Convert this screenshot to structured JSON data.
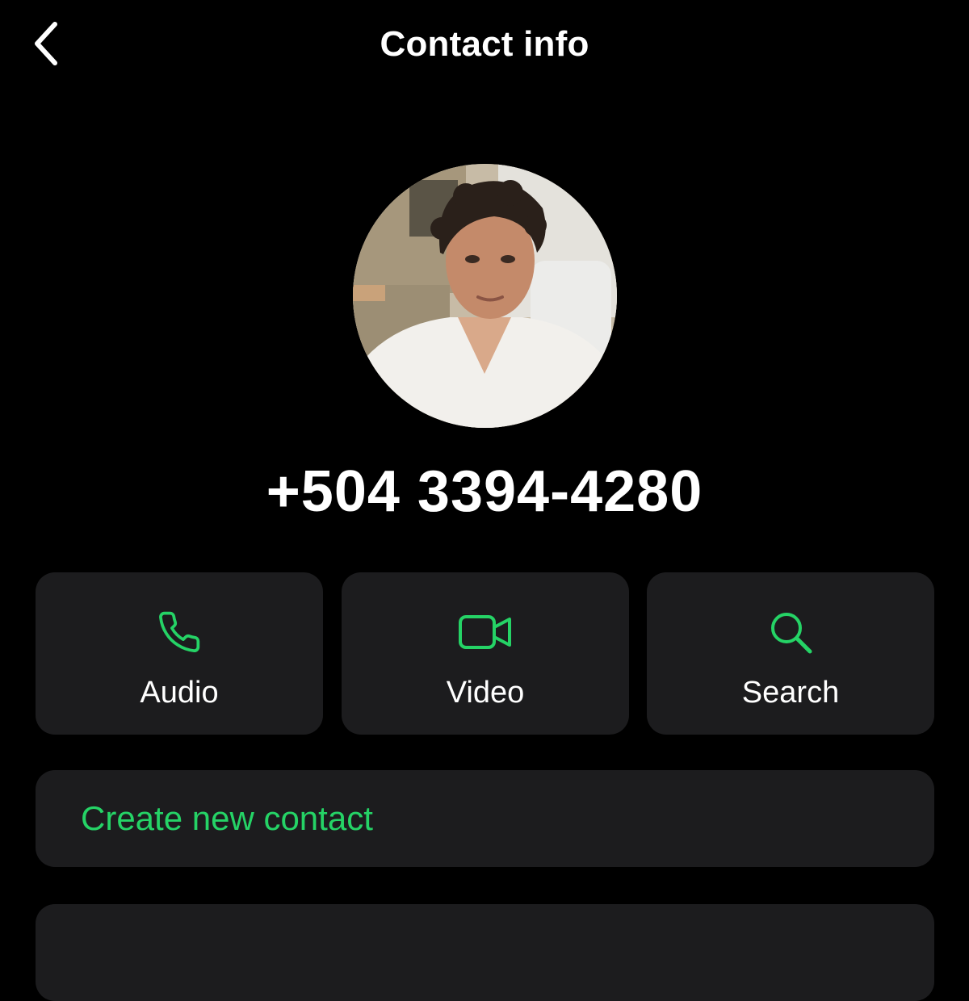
{
  "header": {
    "title": "Contact info",
    "back_icon": "chevron-left-icon"
  },
  "contact": {
    "phone": "+504 3394-4280",
    "avatar": "profile-photo"
  },
  "actions": [
    {
      "label": "Audio",
      "icon": "phone-icon"
    },
    {
      "label": "Video",
      "icon": "video-camera-icon"
    },
    {
      "label": "Search",
      "icon": "search-icon"
    }
  ],
  "create_contact": {
    "label": "Create new contact"
  },
  "colors": {
    "background": "#000000",
    "card": "#1c1c1e",
    "accent": "#25d366",
    "text": "#ffffff"
  }
}
